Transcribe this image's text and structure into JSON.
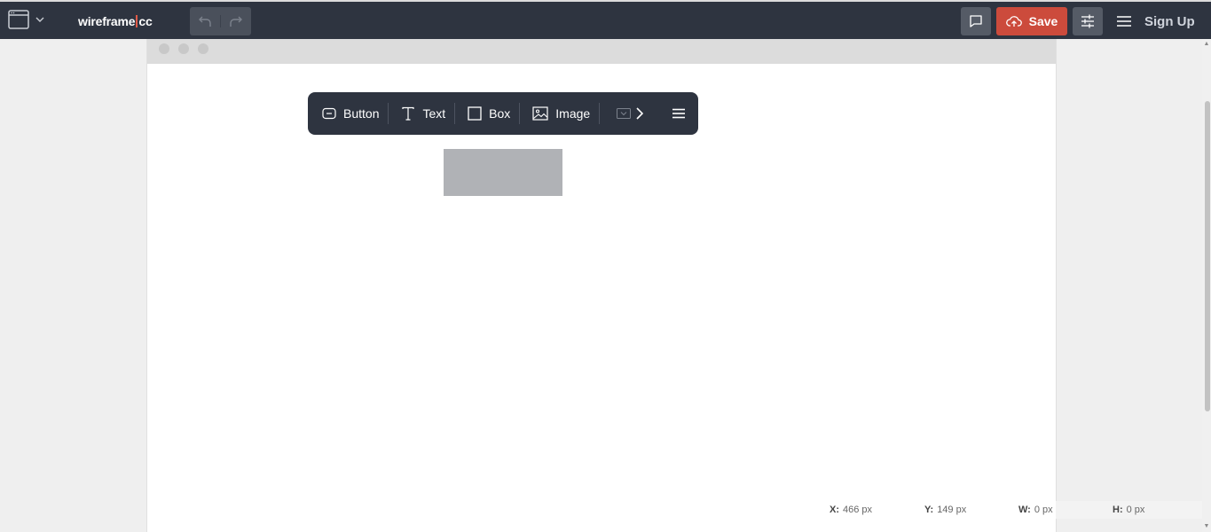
{
  "app": {
    "logo_left": "wireframe",
    "logo_right": "cc",
    "icons": {
      "doc": "browser-window-icon",
      "caret": "chevron-down-icon",
      "undo": "undo-icon",
      "redo": "redo-icon",
      "comment": "comment-icon",
      "cloud": "cloud-upload-icon",
      "settings": "sliders-icon",
      "menu": "hamburger-menu-icon"
    },
    "colors": {
      "topbar": "#2e3440",
      "save": "#cc4b3c",
      "logo_separator": "#e05a47"
    }
  },
  "header": {
    "save_label": "Save",
    "signup_label": "Sign Up"
  },
  "toolbar": {
    "items": [
      {
        "label": "Button",
        "icon": "button-icon"
      },
      {
        "label": "Text",
        "icon": "text-icon"
      },
      {
        "label": "Box",
        "icon": "box-icon"
      },
      {
        "label": "Image",
        "icon": "image-icon"
      }
    ],
    "more_icon": "dropdown-icon",
    "next_icon": "chevron-right-icon",
    "menu_icon": "hamburger-menu-icon"
  },
  "status": {
    "x_label": "X:",
    "x_value": "466 px",
    "y_label": "Y:",
    "y_value": "149 px",
    "w_label": "W:",
    "w_value": "0 px",
    "h_label": "H:",
    "h_value": "0 px"
  }
}
